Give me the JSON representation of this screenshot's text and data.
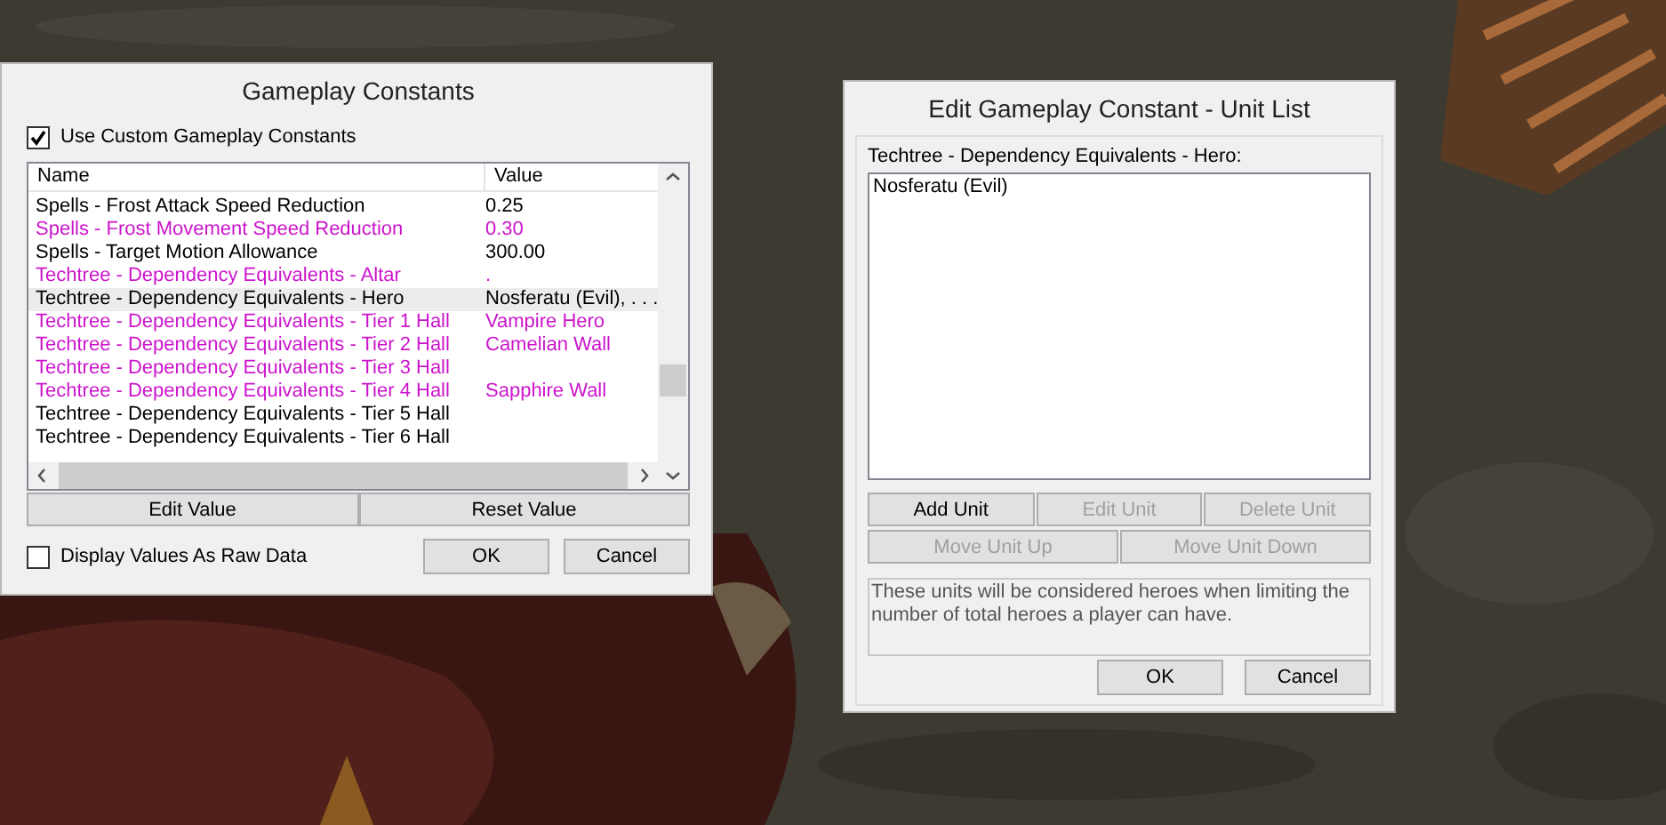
{
  "constants_window": {
    "title": "Gameplay Constants",
    "use_custom": {
      "label": "Use Custom Gameplay Constants",
      "checked": true
    },
    "table": {
      "columns": [
        "Name",
        "Value"
      ],
      "rows": [
        {
          "name": "Spells - Frost Attack Speed Reduction",
          "value": "0.25",
          "modified": false,
          "selected": false
        },
        {
          "name": "Spells - Frost Movement Speed Reduction",
          "value": "0.30",
          "modified": true,
          "selected": false
        },
        {
          "name": "Spells - Target Motion Allowance",
          "value": "300.00",
          "modified": false,
          "selected": false
        },
        {
          "name": "Techtree - Dependency Equivalents - Altar",
          "value": ".",
          "modified": true,
          "selected": false
        },
        {
          "name": "Techtree - Dependency Equivalents - Hero",
          "value": "Nosferatu (Evil), . . .",
          "modified": false,
          "selected": true
        },
        {
          "name": "Techtree - Dependency Equivalents - Tier 1 Hall",
          "value": "Vampire Hero",
          "modified": true,
          "selected": false
        },
        {
          "name": "Techtree - Dependency Equivalents - Tier 2 Hall",
          "value": "Camelian Wall",
          "modified": true,
          "selected": false
        },
        {
          "name": "Techtree - Dependency Equivalents - Tier 3 Hall",
          "value": "",
          "modified": true,
          "selected": false
        },
        {
          "name": "Techtree - Dependency Equivalents - Tier 4 Hall",
          "value": "Sapphire Wall",
          "modified": true,
          "selected": false
        },
        {
          "name": "Techtree - Dependency Equivalents - Tier 5 Hall",
          "value": "",
          "modified": false,
          "selected": false
        },
        {
          "name": "Techtree - Dependency Equivalents - Tier 6 Hall",
          "value": "",
          "modified": false,
          "selected": false
        }
      ]
    },
    "buttons": [
      "Edit Value",
      "Reset Value"
    ],
    "raw_data": {
      "label": "Display Values As Raw Data",
      "checked": false
    },
    "dialog_buttons": [
      "OK",
      "Cancel"
    ]
  },
  "unit_list_window": {
    "title": "Edit Gameplay Constant - Unit List",
    "list_label": "Techtree - Dependency Equivalents - Hero:",
    "units": [
      {
        "name": "Nosferatu (Evil)",
        "selected": false
      }
    ],
    "buttons": [
      {
        "label": "Add Unit",
        "disabled": false
      },
      {
        "label": "Edit Unit",
        "disabled": true
      },
      {
        "label": "Delete Unit",
        "disabled": true
      },
      {
        "label": "Move Unit Up",
        "disabled": true
      },
      {
        "label": "Move Unit Down",
        "disabled": true
      }
    ],
    "description": "These units will be considered heroes when limiting the number of total heroes a player can have.",
    "dialog_buttons": [
      "OK",
      "Cancel"
    ]
  }
}
